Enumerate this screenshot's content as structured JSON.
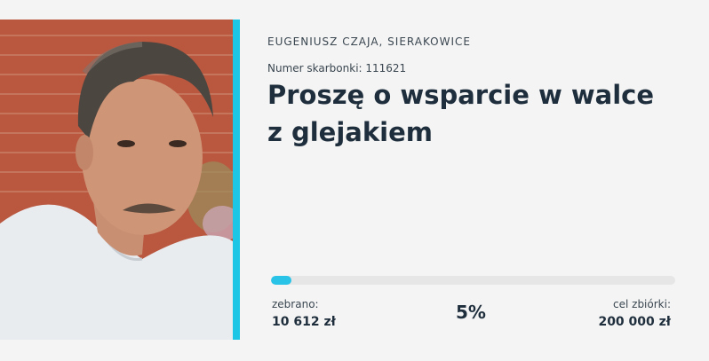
{
  "fundraiser": {
    "author": "EUGENIUSZ CZAJA, SIERAKOWICE",
    "piggy_bank": "Numer skarbonki: 111621",
    "title": "Proszę o wsparcie w walce z glejakiem",
    "photo_icon": "portrait-photo"
  },
  "progress": {
    "percent_value": 0.05,
    "percent_text": "5%",
    "collected_label": "zebrano:",
    "collected_amount": "10 612 zł",
    "goal_label": "cel zbiórki:",
    "goal_amount": "200 000 zł"
  },
  "colors": {
    "accent": "#1ec6e6",
    "progress_fill": "#29c3e8",
    "progress_track": "#e6e6e6",
    "text_dark": "#1f2e3c"
  }
}
